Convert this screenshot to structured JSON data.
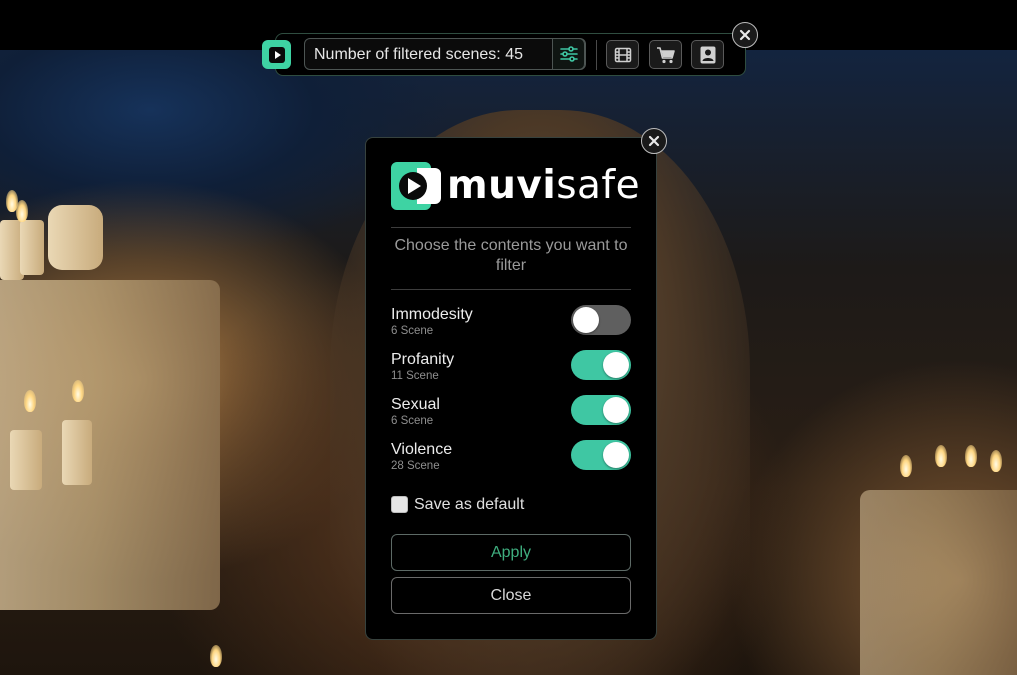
{
  "toolbar": {
    "filtered_label": "Number of filtered scenes: 45",
    "filter_settings_icon": "sliders-icon",
    "film_icon": "film-icon",
    "cart_icon": "cart-icon",
    "account_icon": "user-icon",
    "close_icon": "close-icon"
  },
  "modal": {
    "brand": {
      "bold": "muvi",
      "light": "safe"
    },
    "prompt": "Choose the contents you want to filter",
    "categories": [
      {
        "name": "Immodesity",
        "count": "6 Scene",
        "enabled": false
      },
      {
        "name": "Profanity",
        "count": "11 Scene",
        "enabled": true
      },
      {
        "name": "Sexual",
        "count": "6 Scene",
        "enabled": true
      },
      {
        "name": "Violence",
        "count": "28 Scene",
        "enabled": true
      }
    ],
    "save_default_label": "Save as default",
    "save_default_checked": false,
    "apply_label": "Apply",
    "close_label": "Close"
  },
  "colors": {
    "accent": "#3fc7a3",
    "apply_text": "#3fae7f",
    "toggle_off": "#5f5f5f",
    "panel_bg": "#000000"
  }
}
